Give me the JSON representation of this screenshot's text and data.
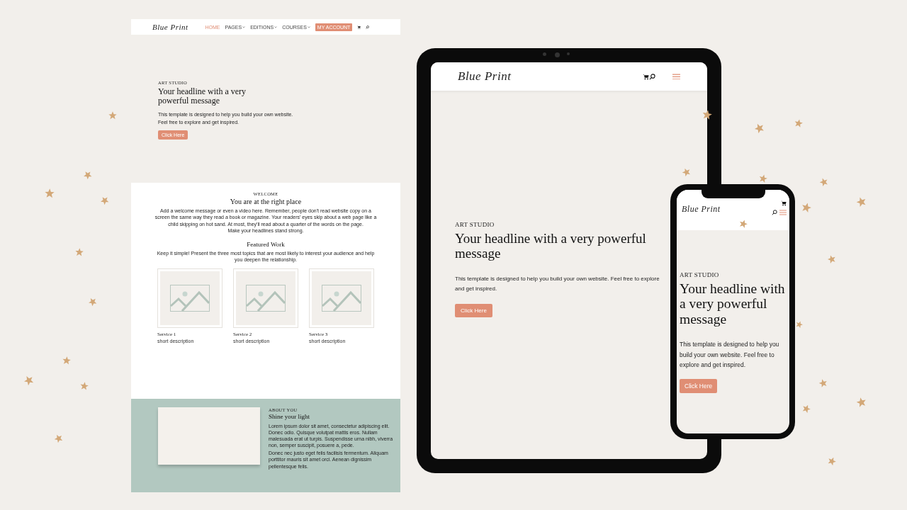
{
  "desktop_page": {
    "logo": "Blue Print",
    "nav": [
      {
        "label": "HOME",
        "selected": true,
        "has_menu": false
      },
      {
        "label": "PAGES",
        "selected": false,
        "has_menu": true
      },
      {
        "label": "EDITIONS",
        "selected": false,
        "has_menu": true
      },
      {
        "label": "COURSES",
        "selected": false,
        "has_menu": true
      }
    ],
    "account_button": "MY ACCOUNT",
    "hero": {
      "eyebrow": "ART STUDIO",
      "headline": "Your headline with a very powerful message",
      "body": "This template is designed to help you build your own website. Feel free to explore and get inspired.",
      "button": "Click Here"
    },
    "welcome": {
      "eyebrow": "WELCOME",
      "title": "You are at the right place",
      "body": "Add a welcome message or even a video here. Remember, people don't read website copy on a screen the same way they read a book or magazine. Your readers' eyes skip about a web page like a child skipping on hot sand. At most, they'll read about a quarter of the words on the page.",
      "closing": "Make your headlines stand strong."
    },
    "featured": {
      "title": "Featured Work",
      "intro": "Keep it simple! Present the three most topics that are most likely to interest your audience and help you deepen the relationship.",
      "cards": [
        {
          "title": "Service 1",
          "description": "short description"
        },
        {
          "title": "Service 2",
          "description": "short description"
        },
        {
          "title": "Service 3",
          "description": "short description"
        }
      ]
    },
    "about": {
      "eyebrow": "ABOUT YOU",
      "title": "Shine your light",
      "paragraphs": [
        "Lorem ipsum dolor sit amet, consectetur adipiscing elit. Donec odio. Quisque volutpat mattis eros. Nullam malesuada erat ut turpis. Suspendisse urna nibh, viverra non, semper suscipit, posuere a, pede.",
        "Donec nec justo eget felis facilisis fermentum. Aliquam porttitor mauris sit amet orci. Aenean dignissim pellentesque felis."
      ]
    }
  },
  "tablet": {
    "logo": "Blue Print",
    "hero": {
      "eyebrow": "ART STUDIO",
      "headline": "Your headline with a very powerful message",
      "body": "This template is designed to help you build your own website. Feel free to explore and get inspired.",
      "button": "Click Here"
    }
  },
  "phone": {
    "logo": "Blue Print",
    "hero": {
      "eyebrow": "ART STUDIO",
      "headline": "Your headline with a very powerful message",
      "body": "This template is designed to help you build your own website. Feel free to explore and get inspired.",
      "button": "Click Here"
    }
  }
}
